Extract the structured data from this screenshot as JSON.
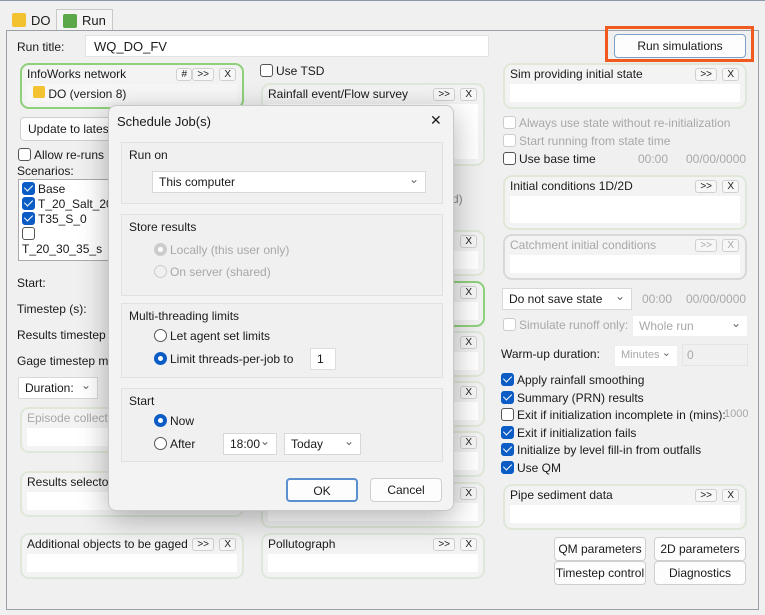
{
  "tabs": [
    {
      "label": "DO",
      "icon": "network-icon"
    },
    {
      "label": "Run",
      "icon": "run-icon"
    }
  ],
  "run_title_label": "Run title:",
  "run_title_value": "WQ_DO_FV",
  "run_simulations": "Run simulations",
  "highlight_color": "#f05a1e",
  "infoworks": {
    "title": "InfoWorks network",
    "hash": "#",
    "more": ">>",
    "clear": "X",
    "item": "DO (version 8)"
  },
  "use_tsd": "Use TSD",
  "rainfall": {
    "title": "Rainfall event/Flow survey",
    "more": ">>",
    "clear": "X"
  },
  "update_latest": "Update to latest",
  "allow_reruns": "Allow re-runs us",
  "scenarios_label": "Scenarios:",
  "scenarios": [
    {
      "label": "Base",
      "checked": true
    },
    {
      "label": "T_20_Salt_20",
      "checked": true
    },
    {
      "label": "T35_S_0",
      "checked": true
    },
    {
      "label": "T_20_30_35_s",
      "checked": false
    }
  ],
  "labels": {
    "start": "Start:",
    "timestep": "Timestep (s):",
    "results_timestep": "Results timestep m",
    "gage_timestep": "Gage timestep mult",
    "duration": "Duration:",
    "d_suffix": "d)"
  },
  "episode": "Episode collection",
  "results_selector": "Results selector",
  "additional": {
    "title": "Additional objects to be gaged",
    "more": ">>",
    "clear": "X"
  },
  "pollutograph": {
    "title": "Pollutograph",
    "more": ">>",
    "clear": "X"
  },
  "middle_clear": "X",
  "right": {
    "sim_initial": {
      "title": "Sim providing initial state",
      "more": ">>",
      "clear": "X"
    },
    "always_use_state": "Always use state without re-initialization",
    "start_running": "Start running from state time",
    "use_base_time": "Use base time",
    "time1": "00:00",
    "date1": "00/00/0000",
    "initial_conditions": {
      "title": "Initial conditions 1D/2D",
      "more": ">>",
      "clear": "X"
    },
    "catchment": {
      "title": "Catchment initial conditions",
      "more": ">>",
      "clear": "X"
    },
    "save_state": "Do not save state",
    "time2": "00:00",
    "date2": "00/00/0000",
    "simulate_runoff": "Simulate runoff only:",
    "whole_run": "Whole run",
    "warmup_label": "Warm-up duration:",
    "warmup_unit": "Minutes",
    "warmup_value": "0",
    "options": [
      {
        "label": "Apply rainfall smoothing",
        "checked": true
      },
      {
        "label": "Summary (PRN) results",
        "checked": true
      },
      {
        "label": "Exit if initialization incomplete in (mins):",
        "checked": false
      },
      {
        "label": "Exit if initialization fails",
        "checked": true
      },
      {
        "label": "Initialize by level fill-in from outfalls",
        "checked": true
      },
      {
        "label": "Use QM",
        "checked": true
      }
    ],
    "exit_mins": "1000",
    "pipe_sediment": {
      "title": "Pipe sediment data",
      "more": ">>",
      "clear": "X"
    },
    "buttons": {
      "qm": "QM parameters",
      "twod": "2D parameters",
      "timestep": "Timestep control",
      "diagnostics": "Diagnostics"
    }
  },
  "dialog": {
    "title": "Schedule Job(s)",
    "close": "✕",
    "run_on_label": "Run on",
    "run_on_value": "This computer",
    "store_label": "Store results",
    "store_local": "Locally (this user only)",
    "store_server": "On server (shared)",
    "mt_label": "Multi-threading limits",
    "mt_agent": "Let agent set limits",
    "mt_limit": "Limit threads-per-job to",
    "mt_value": "1",
    "start_label": "Start",
    "start_now": "Now",
    "start_after": "After",
    "after_time": "18:00",
    "after_day": "Today",
    "ok": "OK",
    "cancel": "Cancel"
  }
}
